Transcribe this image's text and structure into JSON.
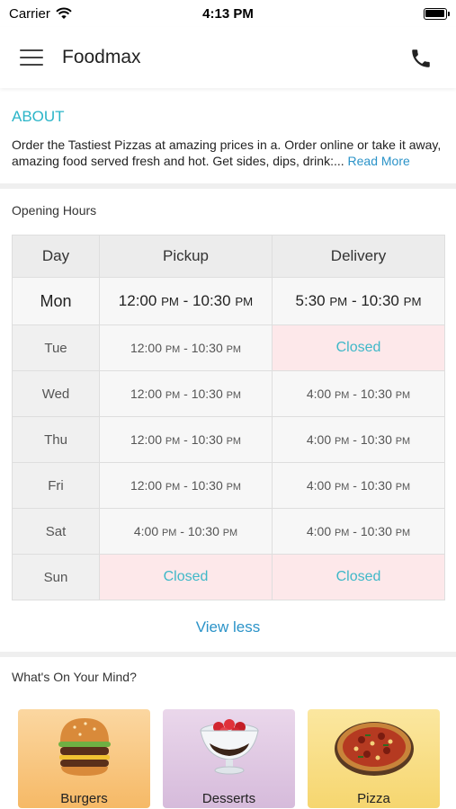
{
  "status_bar": {
    "carrier": "Carrier",
    "time": "4:13 PM",
    "battery_level": 1.0
  },
  "nav": {
    "title": "Foodmax",
    "menu_icon": "hamburger-menu-icon",
    "call_icon": "phone-icon"
  },
  "about": {
    "title": "ABOUT",
    "text": "Order the Tastiest Pizzas at amazing prices in a. Order online or take it away, amazing food served fresh and hot. Get sides, dips, drink:...",
    "read_more": "Read More"
  },
  "hours": {
    "title": "Opening Hours",
    "headers": [
      "Day",
      "Pickup",
      "Delivery"
    ],
    "rows": [
      {
        "day": "Mon",
        "pickup": {
          "open": "12:00",
          "open_pm": "PM",
          "sep": " - ",
          "close": "10:30",
          "close_pm": "PM"
        },
        "delivery": {
          "open": "5:30",
          "open_pm": "PM",
          "sep": " - ",
          "close": "10:30",
          "close_pm": "PM"
        }
      },
      {
        "day": "Tue",
        "pickup": {
          "open": "12:00",
          "open_pm": "PM",
          "sep": " - ",
          "close": "10:30",
          "close_pm": "PM"
        },
        "delivery_closed": "Closed"
      },
      {
        "day": "Wed",
        "pickup": {
          "open": "12:00",
          "open_pm": "PM",
          "sep": " - ",
          "close": "10:30",
          "close_pm": "PM"
        },
        "delivery": {
          "open": "4:00",
          "open_pm": "PM",
          "sep": " - ",
          "close": "10:30",
          "close_pm": "PM"
        }
      },
      {
        "day": "Thu",
        "pickup": {
          "open": "12:00",
          "open_pm": "PM",
          "sep": " - ",
          "close": "10:30",
          "close_pm": "PM"
        },
        "delivery": {
          "open": "4:00",
          "open_pm": "PM",
          "sep": " - ",
          "close": "10:30",
          "close_pm": "PM"
        }
      },
      {
        "day": "Fri",
        "pickup": {
          "open": "12:00",
          "open_pm": "PM",
          "sep": " - ",
          "close": "10:30",
          "close_pm": "PM"
        },
        "delivery": {
          "open": "4:00",
          "open_pm": "PM",
          "sep": " - ",
          "close": "10:30",
          "close_pm": "PM"
        }
      },
      {
        "day": "Sat",
        "pickup": {
          "open": "4:00",
          "open_pm": "PM",
          "sep": " - ",
          "close": "10:30",
          "close_pm": "PM"
        },
        "delivery": {
          "open": "4:00",
          "open_pm": "PM",
          "sep": " - ",
          "close": "10:30",
          "close_pm": "PM"
        }
      },
      {
        "day": "Sun",
        "pickup_closed": "Closed",
        "delivery_closed": "Closed"
      }
    ],
    "view_less": "View less"
  },
  "mind": {
    "title": "What's On Your Mind?",
    "cards": [
      {
        "label": "Burgers",
        "icon": "burger-image"
      },
      {
        "label": "Desserts",
        "icon": "dessert-image"
      },
      {
        "label": "Pizza",
        "icon": "pizza-image"
      }
    ]
  },
  "colors": {
    "accent": "#2bb5c8",
    "link": "#2b93c8",
    "closed_bg": "#fde8ea"
  }
}
